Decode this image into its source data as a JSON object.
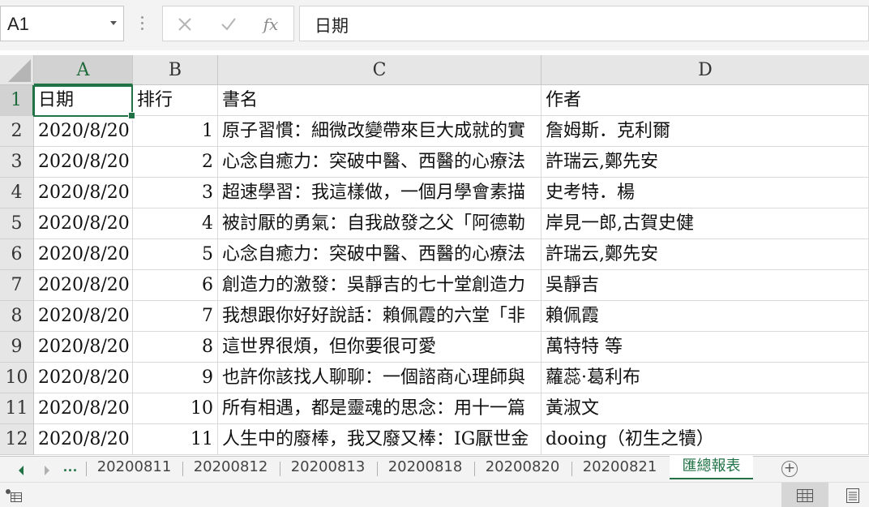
{
  "name_box": {
    "value": "A1"
  },
  "formula_bar": {
    "cancel_icon": "x-icon",
    "enter_icon": "check-icon",
    "fx_label": "fx",
    "content": "日期"
  },
  "columns": [
    "A",
    "B",
    "C",
    "D"
  ],
  "header_row": {
    "row": "1",
    "a": "日期",
    "b": "排行",
    "c": "書名",
    "d": "作者"
  },
  "rows": [
    {
      "row": "2",
      "date": "2020/8/20",
      "rank": "1",
      "title": "原子習慣：細微改變帶來巨大成就的實",
      "author": "詹姆斯．克利爾"
    },
    {
      "row": "3",
      "date": "2020/8/20",
      "rank": "2",
      "title": "心念自癒力：突破中醫、西醫的心療法",
      "author": "許瑞云,鄭先安"
    },
    {
      "row": "4",
      "date": "2020/8/20",
      "rank": "3",
      "title": "超速學習：我這樣做，一個月學會素描",
      "author": "史考特．楊"
    },
    {
      "row": "5",
      "date": "2020/8/20",
      "rank": "4",
      "title": "被討厭的勇氣：自我啟發之父「阿德勒",
      "author": "岸見一郎,古賀史健"
    },
    {
      "row": "6",
      "date": "2020/8/20",
      "rank": "5",
      "title": "心念自癒力：突破中醫、西醫的心療法",
      "author": "許瑞云,鄭先安"
    },
    {
      "row": "7",
      "date": "2020/8/20",
      "rank": "6",
      "title": "創造力的激發：吳靜吉的七十堂創造力",
      "author": "吳靜吉"
    },
    {
      "row": "8",
      "date": "2020/8/20",
      "rank": "7",
      "title": "我想跟你好好說話：賴佩霞的六堂「非",
      "author": "賴佩霞"
    },
    {
      "row": "9",
      "date": "2020/8/20",
      "rank": "8",
      "title": "這世界很煩，但你要很可愛",
      "author": "萬特特 等"
    },
    {
      "row": "10",
      "date": "2020/8/20",
      "rank": "9",
      "title": "也許你該找人聊聊：一個諮商心理師與",
      "author": "蘿蕊·葛利布"
    },
    {
      "row": "11",
      "date": "2020/8/20",
      "rank": "10",
      "title": "所有相遇，都是靈魂的思念：用十一篇",
      "author": "黃淑文"
    },
    {
      "row": "12",
      "date": "2020/8/20",
      "rank": "11",
      "title": "人生中的廢棒，我又廢又棒：IG厭世金",
      "author": "dooing（初生之犢）"
    }
  ],
  "sheet_tabs": {
    "more": "...",
    "tabs": [
      "20200811",
      "20200812",
      "20200813",
      "20200818",
      "20200820",
      "20200821"
    ],
    "active": "匯總報表",
    "add": "+"
  },
  "colors": {
    "accent": "#217346",
    "header_bg": "#e6e6e6",
    "selected_header_bg": "#d2d2d2"
  }
}
